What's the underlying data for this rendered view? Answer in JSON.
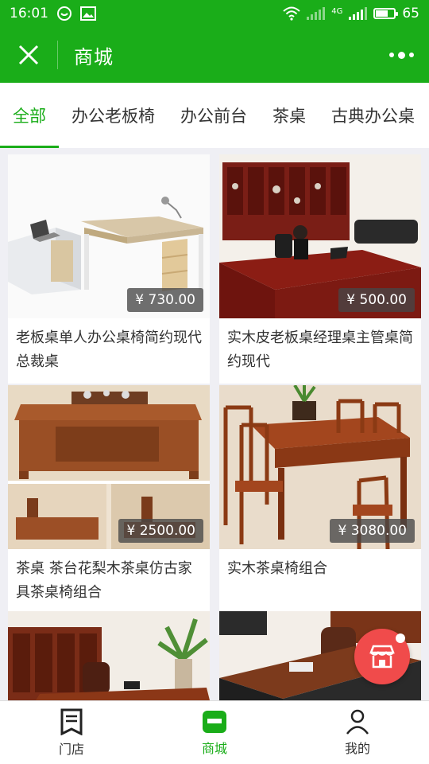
{
  "status": {
    "time": "16:01",
    "network": "4G",
    "battery": "65",
    "battery_level": 0.65
  },
  "header": {
    "title": "商城"
  },
  "tabs": [
    {
      "label": "全部",
      "active": true
    },
    {
      "label": "办公老板椅",
      "active": false
    },
    {
      "label": "办公前台",
      "active": false
    },
    {
      "label": "茶桌",
      "active": false
    },
    {
      "label": "古典办公桌",
      "active": false
    }
  ],
  "products": [
    {
      "name": "老板桌单人办公桌椅简约现代总裁桌",
      "price": "¥ 730.00",
      "image": "modern-office-desk"
    },
    {
      "name": "实木皮老板桌经理桌主管桌简约现代",
      "price": "¥ 500.00",
      "image": "wood-boss-desk"
    },
    {
      "name": "茶桌 茶台花梨木茶桌仿古家具茶桌椅组合",
      "price": "¥ 2500.00",
      "image": "tea-table"
    },
    {
      "name": "实木茶桌椅组合",
      "price": "¥ 3080.00",
      "image": "tea-table-chairs"
    },
    {
      "name": "",
      "price": "",
      "image": "classic-office"
    },
    {
      "name": "",
      "price": "",
      "image": "executive-desk"
    }
  ],
  "nav": [
    {
      "label": "门店",
      "icon": "store-doc-icon",
      "active": false
    },
    {
      "label": "商城",
      "icon": "mall-icon",
      "active": true
    },
    {
      "label": "我的",
      "icon": "person-icon",
      "active": false
    }
  ],
  "colors": {
    "brand": "#1aad19",
    "fab": "#f04b4b"
  }
}
